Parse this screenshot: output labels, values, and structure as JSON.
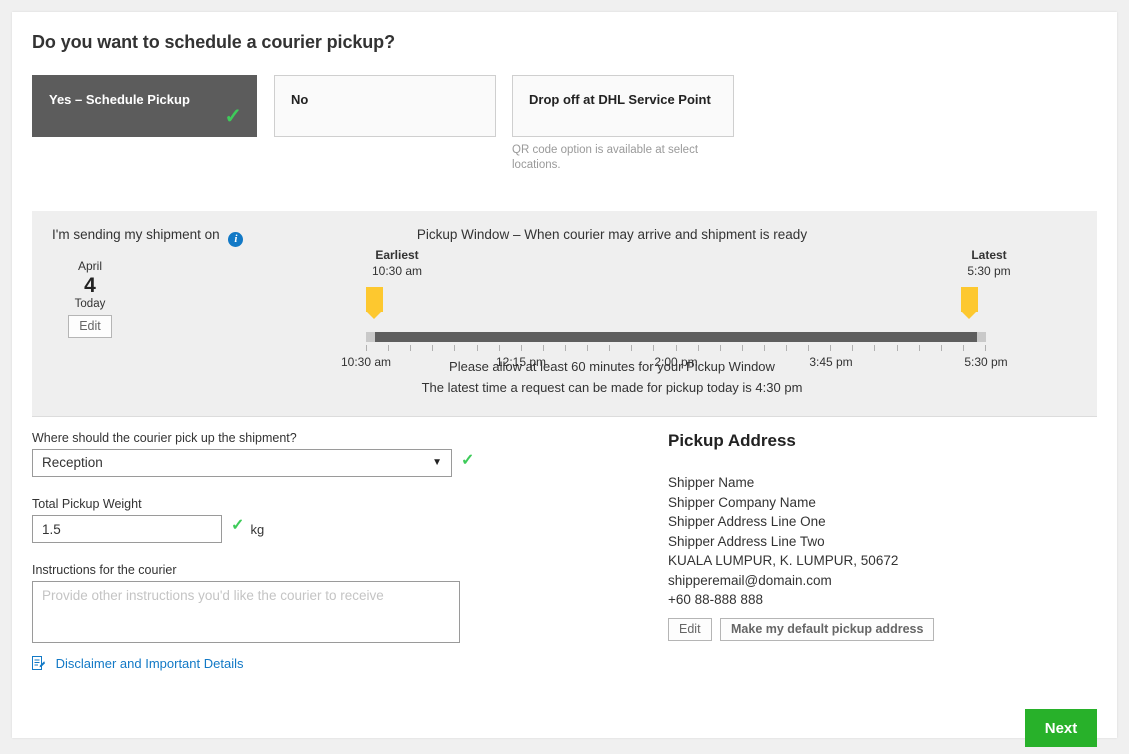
{
  "page": {
    "title": "Do you want to schedule a courier pickup?"
  },
  "options": [
    {
      "label": "Yes – Schedule Pickup",
      "selected": true
    },
    {
      "label": "No",
      "selected": false
    },
    {
      "label": "Drop off at DHL Service Point",
      "selected": false
    }
  ],
  "qr_note": "QR code option is available at select locations.",
  "pickup_window": {
    "sending_label": "I'm sending my shipment on",
    "info_icon": "info-icon",
    "date": {
      "month": "April",
      "day": "4",
      "relative": "Today",
      "edit_label": "Edit"
    },
    "heading": "Pickup Window – When courier may arrive and shipment is ready",
    "earliest_caption": "Earliest",
    "earliest_value": "10:30 am",
    "latest_caption": "Latest",
    "latest_value": "5:30 pm",
    "tick_labels": [
      "10:30 am",
      "12:15 pm",
      "2:00 pm",
      "3:45 pm",
      "5:30 pm"
    ],
    "tick_count": 29,
    "note_line_1": "Please allow at least 60 minutes for your Pickup Window",
    "note_line_2": "The latest time a request can be made for pickup today is 4:30 pm"
  },
  "form": {
    "location_label": "Where should the courier pick up the shipment?",
    "location_value": "Reception",
    "weight_label": "Total Pickup Weight",
    "weight_value": "1.5",
    "weight_unit": "kg",
    "instructions_label": "Instructions for the courier",
    "instructions_value": "",
    "instructions_placeholder": "Provide other instructions you'd like the courier to receive",
    "disclaimer_label": "Disclaimer and Important Details"
  },
  "address": {
    "heading": "Pickup Address",
    "lines": [
      "Shipper Name",
      "Shipper Company Name",
      "Shipper Address Line One",
      "Shipper Address Line Two",
      "KUALA LUMPUR, K. LUMPUR, 50672",
      "shipperemail@domain.com",
      "+60 88-888 888"
    ],
    "edit_label": "Edit",
    "default_label": "Make my default pickup address"
  },
  "footer": {
    "next_label": "Next"
  },
  "colors": {
    "accent_green": "#28b12a",
    "check_green": "#3ecb5a",
    "selected_tile": "#5c5c5c",
    "panel_bg": "#efefef",
    "link_blue": "#1279c6",
    "slider_pin": "#fdc82f"
  }
}
